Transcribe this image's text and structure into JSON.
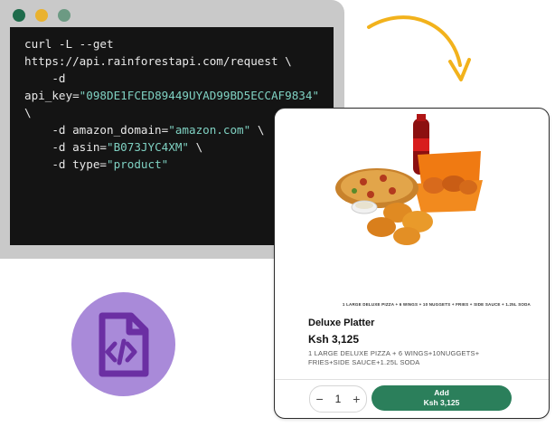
{
  "terminal": {
    "dot_colors": [
      "#1e6b4b",
      "#e9b22f",
      "#6c9a83"
    ],
    "lines": [
      [
        {
          "t": "curl -L --get"
        }
      ],
      [
        {
          "t": "https://api.rainforestapi.com/request \\"
        }
      ],
      [
        {
          "t": "    -d"
        }
      ],
      [
        {
          "t": "api_key="
        },
        {
          "t": "\"098DE1FCED89449UYAD99BD5ECCAF9834\"",
          "s": true
        }
      ],
      [
        {
          "t": "\\"
        }
      ],
      [
        {
          "t": "    -d amazon_domain="
        },
        {
          "t": "\"amazon.com\"",
          "s": true
        },
        {
          "t": " \\"
        }
      ],
      [
        {
          "t": "    -d asin="
        },
        {
          "t": "\"B073JYC4XM\"",
          "s": true
        },
        {
          "t": " \\"
        }
      ],
      [
        {
          "t": "    -d type="
        },
        {
          "t": "\"product\"",
          "s": true
        }
      ]
    ]
  },
  "arrow": {
    "color": "#f2b21c"
  },
  "file_icon": {
    "icon": "code-file-icon",
    "badge_color": "#a98ad9",
    "icon_color": "#6b2fa3"
  },
  "product": {
    "tagline": "1 LARGE DELUXE PIZZA + 6 WINGS + 10 NUGGETS + FRIES + SIDE SAUCE + 1.25L SODA",
    "name": "Deluxe Platter",
    "price": "Ksh 3,125",
    "description": "1 LARGE DELUXE PIZZA + 6 WINGS+10NUGGETS+ FRIES+SIDE SAUCE+1.25L SODA",
    "quantity": "1",
    "minus": "−",
    "plus": "+",
    "add_label": "Add",
    "add_price": "Ksh 3,125",
    "accent": "#2b7f5b"
  }
}
